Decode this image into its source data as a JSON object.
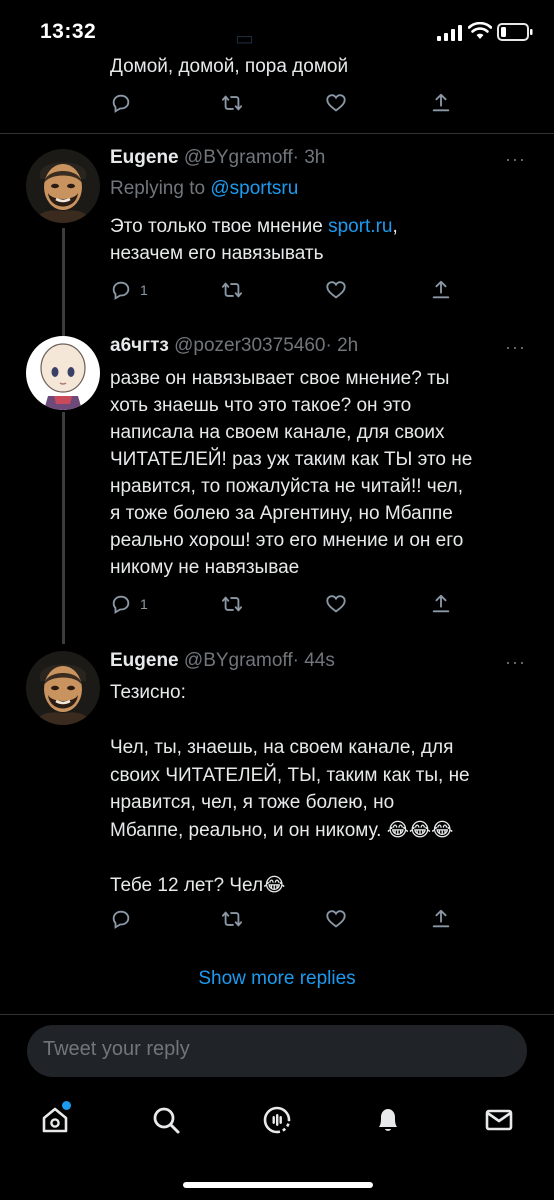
{
  "status_bar": {
    "time": "13:32"
  },
  "previous_tweet": {
    "text": "Домой, домой, пора домой"
  },
  "tweets": [
    {
      "name": "Eugene",
      "handle": "@BYgramoff",
      "time": "· 3h",
      "replying_label": "Replying to",
      "replying_to": "@sportsru",
      "body_before_link": "Это только твое мнение ",
      "body_link": "sport.ru",
      "body_after_link": ",",
      "body_line2": "незачем его навязывать",
      "reply_count": "1"
    },
    {
      "name": "а6чгтз",
      "handle": "@pozer30375460",
      "time": "· 2h",
      "body_lines": [
        "разве он навязывает свое мнение? ты",
        "хоть знаешь что это такое? он это",
        "написала на своем канале, для своих",
        "ЧИТАТЕЛЕЙ! раз уж таким как ТЫ это не",
        "нравится,  то пожалуйста не читай!! чел,",
        "я тоже болею за Аргентину, но Мбаппе",
        "реально хорош! это его мнение и он его",
        "никому не навязывае"
      ],
      "reply_count": "1"
    },
    {
      "name": "Eugene",
      "handle": "@BYgramoff",
      "time": "· 44s",
      "body_lines": [
        "Тезисно:",
        "",
        "Чел, ты, знаешь, на своем канале, для",
        "своих ЧИТАТЕЛЕЙ, ТЫ, таким как ты, не",
        "нравится, чел, я тоже болею, но",
        "Мбаппе, реально, и он никому. 😂😂😂",
        "",
        "Тебе 12 лет? Чел😂"
      ]
    }
  ],
  "more_label": "···",
  "show_more_replies": "Show more replies",
  "composer": {
    "placeholder": "Tweet your reply"
  },
  "tabbar": {
    "items": [
      "home-icon",
      "search-icon",
      "spaces-icon",
      "notifications-icon",
      "messages-icon"
    ]
  },
  "colors": {
    "accent": "#1d9bf0",
    "background": "#000000",
    "muted": "#71767b"
  }
}
